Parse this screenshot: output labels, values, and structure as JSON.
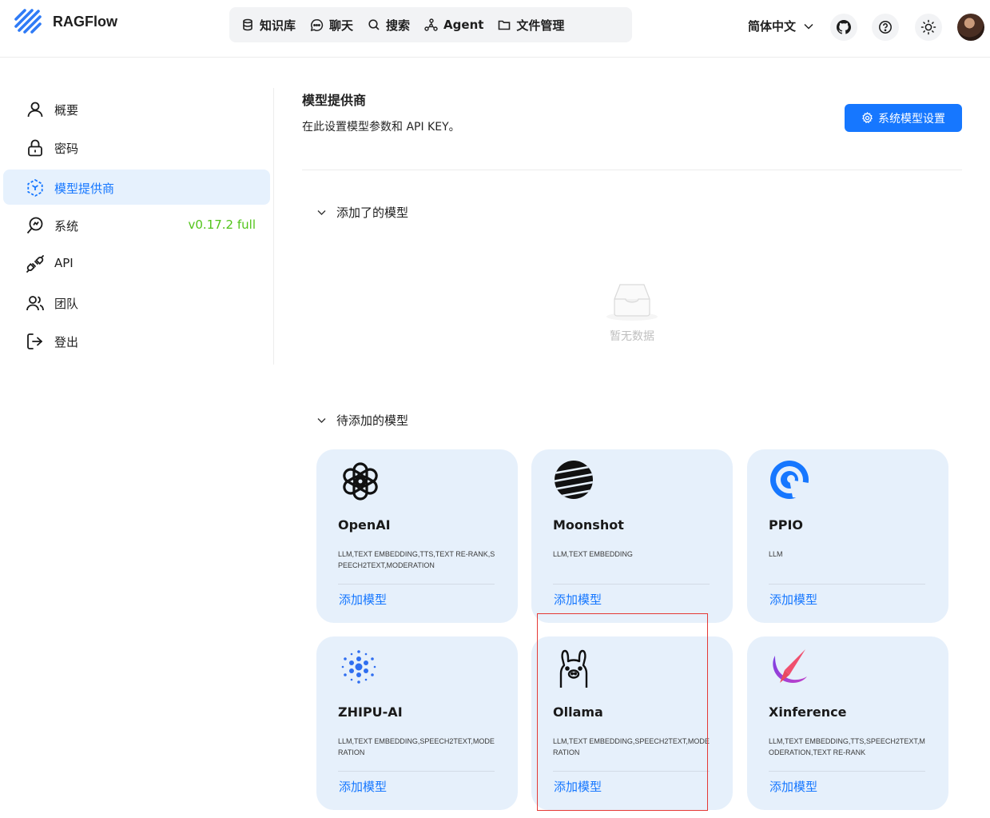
{
  "app": {
    "name": "RAGFlow"
  },
  "nav": {
    "items": [
      {
        "label": "知识库",
        "icon": "database-icon"
      },
      {
        "label": "聊天",
        "icon": "chat-icon"
      },
      {
        "label": "搜索",
        "icon": "search-icon"
      },
      {
        "label": "Agent",
        "icon": "agent-icon"
      },
      {
        "label": "文件管理",
        "icon": "folder-icon"
      }
    ]
  },
  "header": {
    "language": "简体中文"
  },
  "sidebar": {
    "items": [
      {
        "label": "概要",
        "icon": "user-icon"
      },
      {
        "label": "密码",
        "icon": "lock-icon"
      },
      {
        "label": "模型提供商",
        "icon": "model-provider-icon",
        "active": true
      },
      {
        "label": "系统",
        "icon": "system-icon",
        "badge": "v0.17.2 full"
      },
      {
        "label": "API",
        "icon": "plug-icon"
      },
      {
        "label": "团队",
        "icon": "team-icon"
      },
      {
        "label": "登出",
        "icon": "logout-icon"
      }
    ]
  },
  "main": {
    "title": "模型提供商",
    "description": "在此设置模型参数和 API KEY。",
    "system_button": "系统模型设置",
    "added_section": "添加了的模型",
    "empty_text": "暂无数据",
    "pending_section": "待添加的模型",
    "providers": [
      {
        "name": "OpenAI",
        "tags": "LLM,TEXT EMBEDDING,TTS,TEXT RE-RANK,SPEECH2TEXT,MODERATION",
        "action": "添加模型",
        "logo": "openai-logo"
      },
      {
        "name": "Moonshot",
        "tags": "LLM,TEXT EMBEDDING",
        "action": "添加模型",
        "logo": "moonshot-logo"
      },
      {
        "name": "PPIO",
        "tags": "LLM",
        "action": "添加模型",
        "logo": "ppio-logo"
      },
      {
        "name": "ZHIPU-AI",
        "tags": "LLM,TEXT EMBEDDING,SPEECH2TEXT,MODERATION",
        "action": "添加模型",
        "logo": "zhipu-logo"
      },
      {
        "name": "Ollama",
        "tags": "LLM,TEXT EMBEDDING,SPEECH2TEXT,MODERATION",
        "action": "添加模型",
        "logo": "ollama-logo"
      },
      {
        "name": "Xinference",
        "tags": "LLM,TEXT EMBEDDING,TTS,SPEECH2TEXT,MODERATION,TEXT RE-RANK",
        "action": "添加模型",
        "logo": "xinference-logo"
      }
    ]
  },
  "colors": {
    "accent": "#1677ff",
    "card_bg": "#e6f0fb",
    "active_bg": "#e6f1fd",
    "version_green": "#52c41a",
    "highlight_red": "#e53935"
  }
}
